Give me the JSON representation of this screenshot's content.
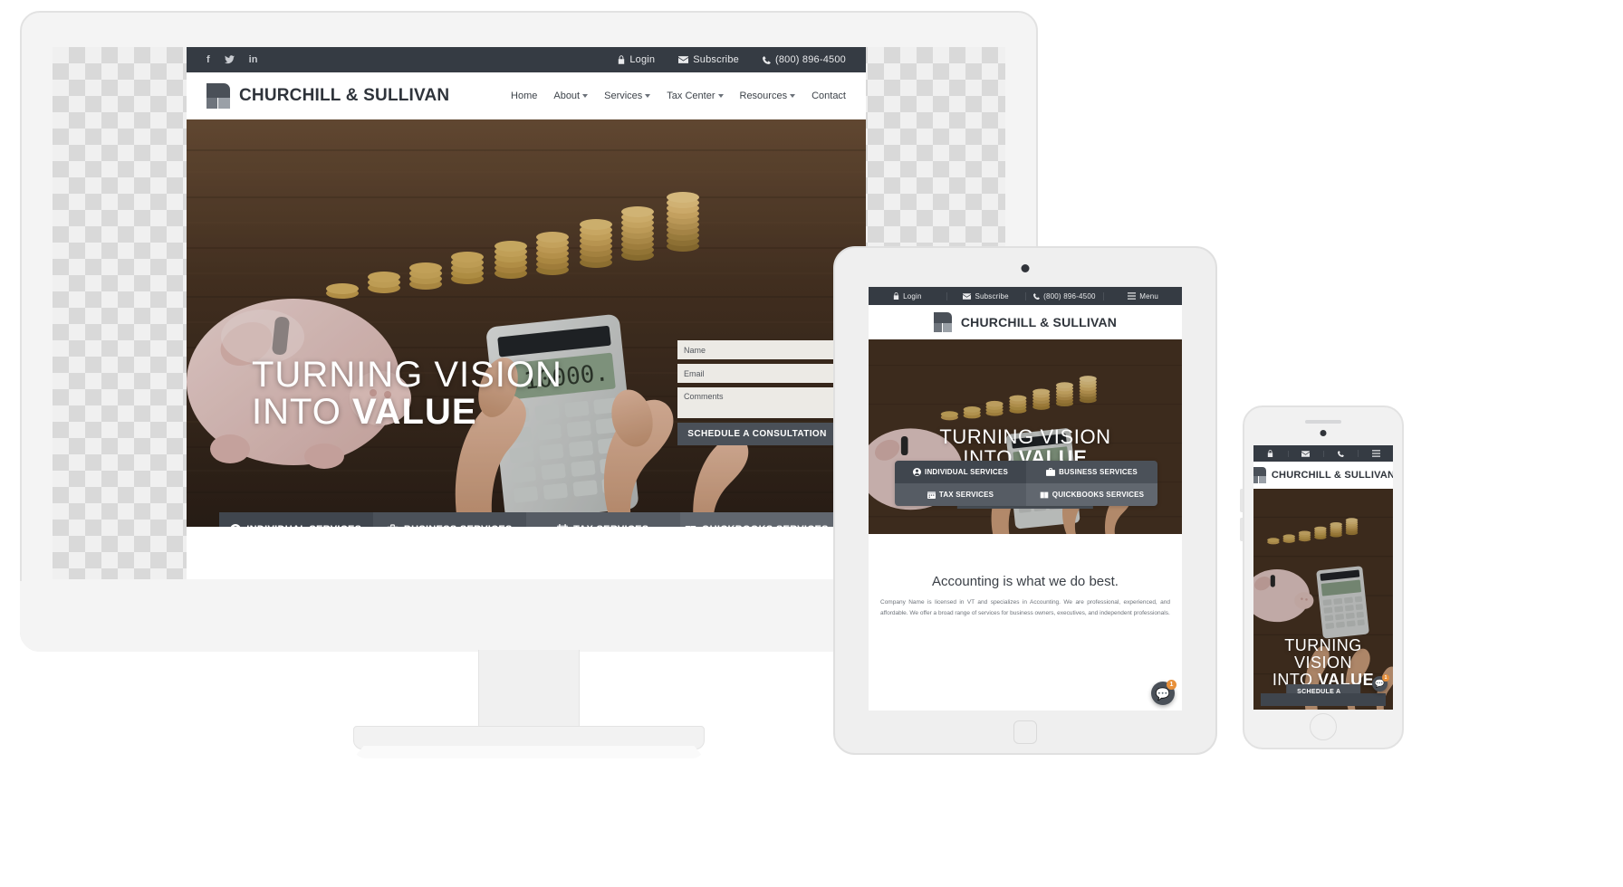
{
  "brand": {
    "name": "CHURCHILL & SULLIVAN",
    "accent": "#353b43",
    "accent_light": "#4a5058",
    "badge_color": "#e8903a"
  },
  "topbar": {
    "social": [
      {
        "name": "facebook-icon",
        "glyph": "f"
      },
      {
        "name": "twitter-icon",
        "glyph": "t"
      },
      {
        "name": "linkedin-icon",
        "glyph": "in"
      }
    ],
    "login": "Login",
    "subscribe": "Subscribe",
    "phone": "(800) 896-4500",
    "menu": "Menu"
  },
  "nav": [
    {
      "label": "Home",
      "dropdown": false
    },
    {
      "label": "About",
      "dropdown": true
    },
    {
      "label": "Services",
      "dropdown": true
    },
    {
      "label": "Tax Center",
      "dropdown": true
    },
    {
      "label": "Resources",
      "dropdown": true
    },
    {
      "label": "Contact",
      "dropdown": false
    }
  ],
  "hero": {
    "headline_line1": "TURNING VISION",
    "headline_line2_prefix": "INTO ",
    "headline_line2_strong": "VALUE",
    "cta": "SCHEDULE A CONSULTATION"
  },
  "form": {
    "name_placeholder": "Name",
    "email_placeholder": "Email",
    "comments_placeholder": "Comments",
    "submit_label": "SCHEDULE A CONSULTATION"
  },
  "service_tabs": [
    {
      "label": "INDIVIDUAL SERVICES",
      "icon": "person-circle-icon"
    },
    {
      "label": "BUSINESS SERVICES",
      "icon": "briefcase-icon"
    },
    {
      "label": "TAX SERVICES",
      "icon": "calendar-icon"
    },
    {
      "label": "QUICKBOOKS SERVICES",
      "icon": "book-icon"
    }
  ],
  "tablet_body": {
    "heading": "Accounting is what we do best.",
    "paragraph": "Company Name is licensed in VT and specializes in Accounting. We are professional, experienced, and affordable. We offer a broad range of services for business owners, executives, and independent professionals."
  },
  "chat": {
    "icon": "chat-bubble-icon",
    "badge_count": "1"
  }
}
